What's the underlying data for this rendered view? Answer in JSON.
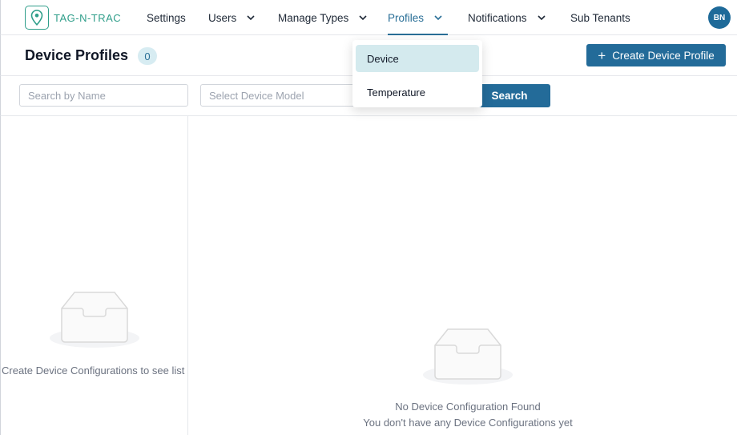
{
  "brand": {
    "logo_text": "TAG-N-TRAC"
  },
  "nav": {
    "items": [
      {
        "label": "Settings",
        "has_chevron": false
      },
      {
        "label": "Users",
        "has_chevron": true
      },
      {
        "label": "Manage Types",
        "has_chevron": true
      },
      {
        "label": "Profiles",
        "has_chevron": true,
        "active": true
      },
      {
        "label": "Notifications",
        "has_chevron": true
      },
      {
        "label": "Sub Tenants",
        "has_chevron": false
      }
    ],
    "avatar_initials": "BN"
  },
  "header": {
    "title": "Device Profiles",
    "count": "0",
    "create_button": "Create Device Profile"
  },
  "filters": {
    "search_placeholder": "Search by Name",
    "model_placeholder": "Select Device Model",
    "search_button": "Search"
  },
  "profiles_menu": {
    "items": [
      {
        "label": "Device",
        "selected": true
      },
      {
        "label": "Temperature",
        "selected": false
      }
    ]
  },
  "left_panel": {
    "empty_message": "Create Device Configurations to see list"
  },
  "right_panel": {
    "empty_title": "No Device Configuration Found",
    "empty_subtitle": "You don't have any Device Configurations yet"
  },
  "colors": {
    "accent": "#236b99",
    "brand": "#2f9e8a",
    "badge_bg": "#d7ecf2",
    "menu_selected_bg": "#d4eaee"
  }
}
